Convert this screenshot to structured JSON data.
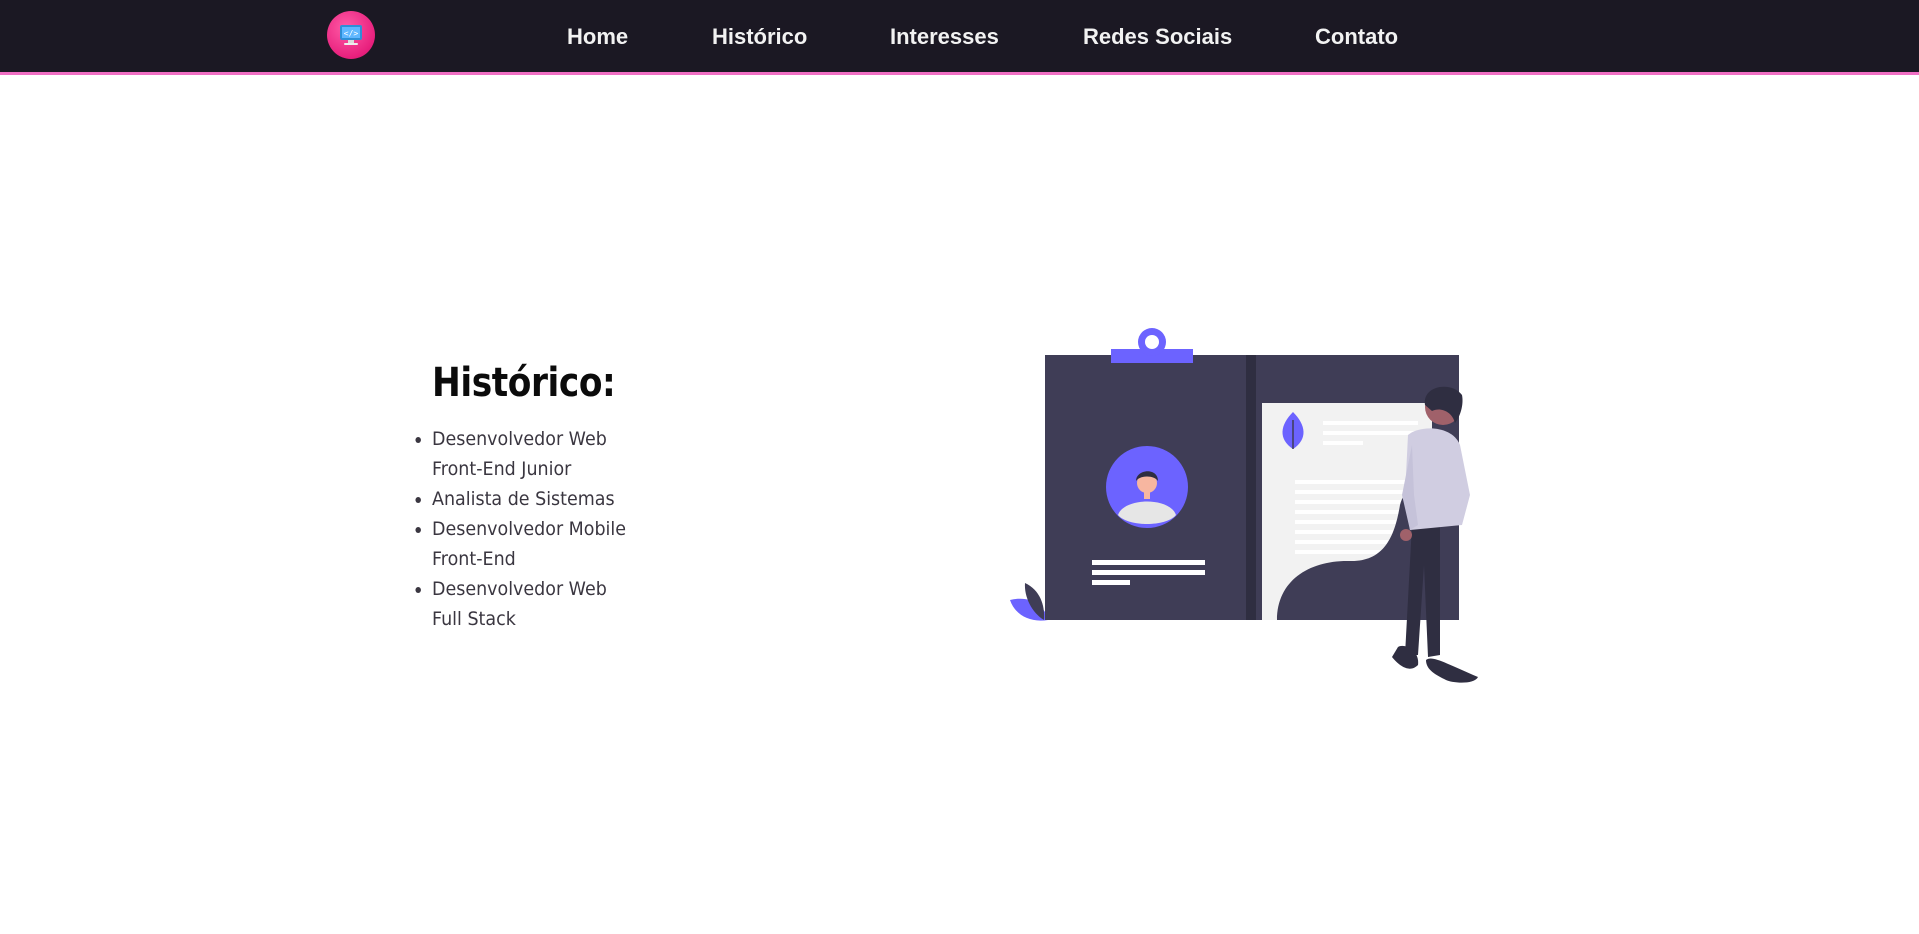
{
  "nav": {
    "logo_icon": "code-monitor-icon",
    "items": [
      {
        "label": "Home"
      },
      {
        "label": "Histórico"
      },
      {
        "label": "Interesses"
      },
      {
        "label": "Redes Sociais"
      },
      {
        "label": "Contato"
      }
    ]
  },
  "main": {
    "title": "Histórico:",
    "history": [
      "Desenvolvedor Web Front-End Junior",
      "Analista de Sistemas",
      "Desenvolvedor Mobile Front-End",
      "Desenvolvedor Web Full Stack"
    ]
  },
  "colors": {
    "navbar_bg": "#1b1823",
    "accent_pink": "#f06fc4",
    "illustration_purple": "#6c63ff",
    "illustration_dark": "#3f3d56"
  }
}
